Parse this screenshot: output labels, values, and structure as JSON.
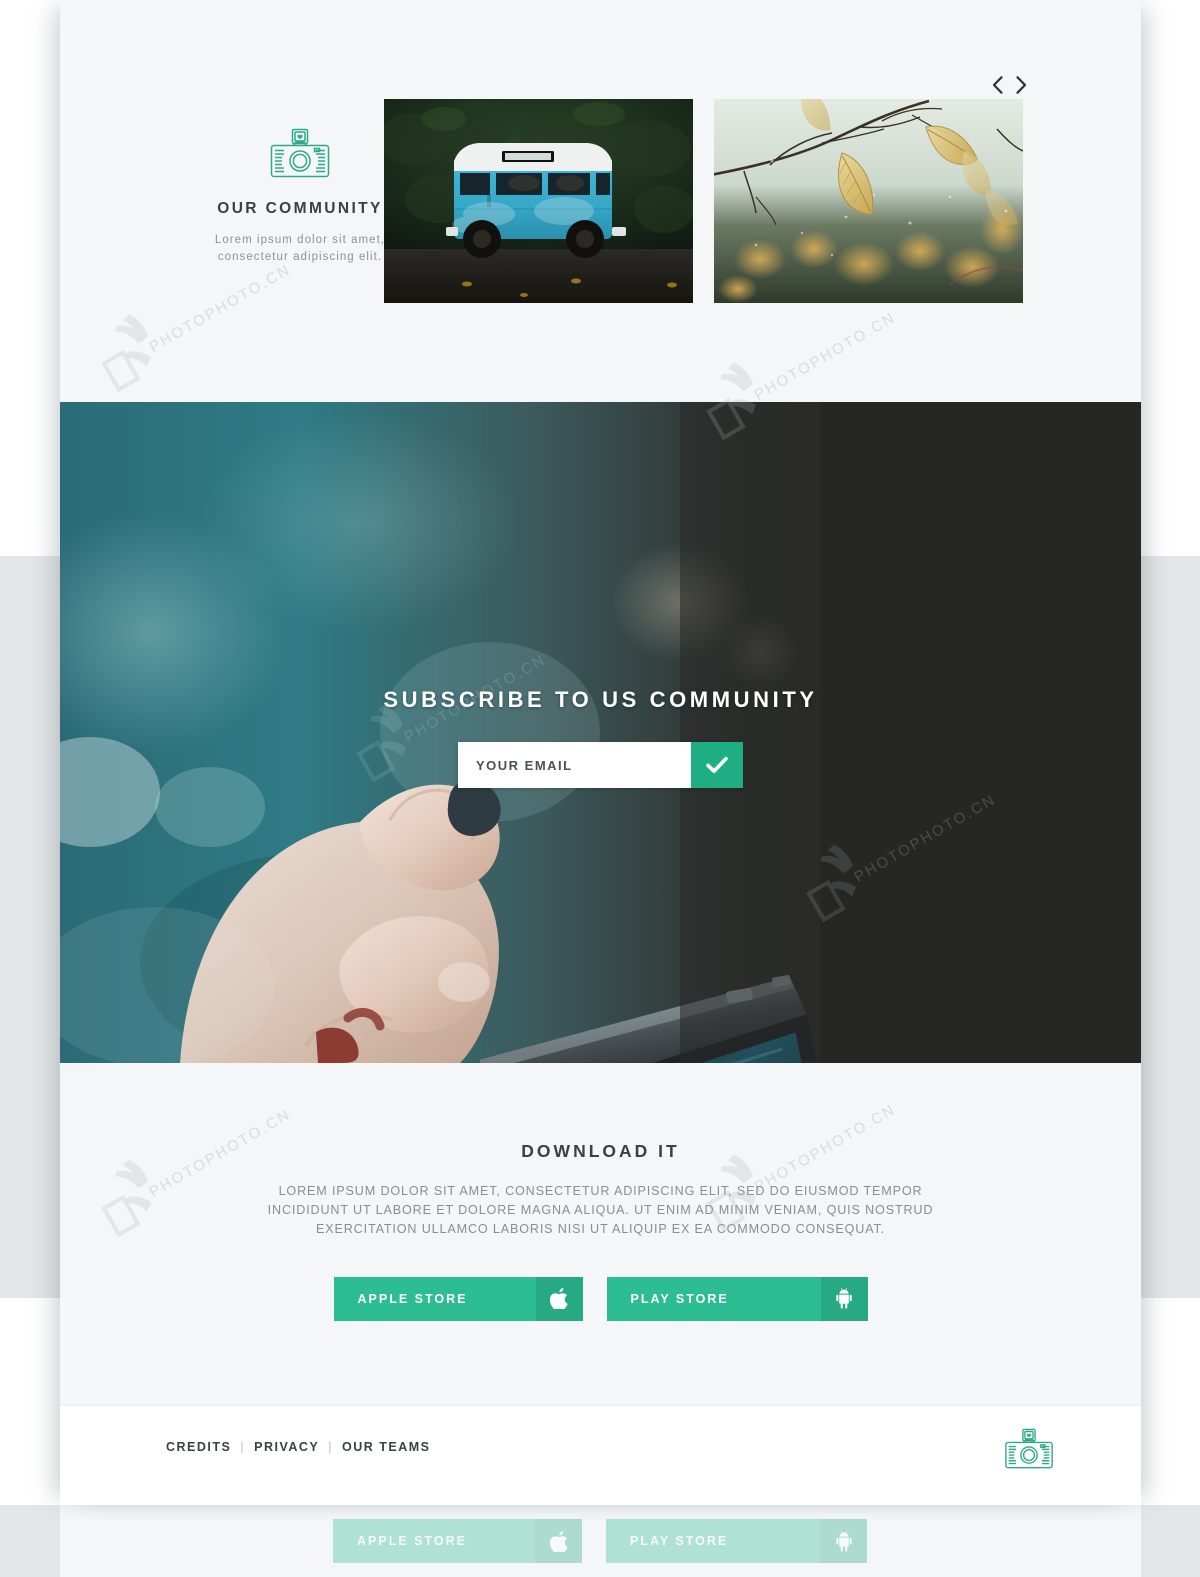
{
  "brand": {
    "accent_teal": "#1fae83",
    "button_green": "#2cbd93",
    "page_bg": "#f4f6f7",
    "text_dark": "#3b4043",
    "text_muted": "#878f93",
    "logo_icon": "camera-heart-icon"
  },
  "community": {
    "title": "OUR COMMUNITY",
    "subtitle": "Lorem ipsum dolor sit amet, consectetur adipiscing elit.",
    "logo_icon": "camera-heart-icon",
    "carousel": {
      "prev_icon": "chevron-left-icon",
      "next_icon": "chevron-right-icon",
      "slides": [
        {
          "alt": "vintage blue camper van parked by dark hedge"
        },
        {
          "alt": "autumn yellow leaves on bare branch, blurred bokeh"
        }
      ]
    }
  },
  "subscribe": {
    "title": "SUBSCRIBE TO US COMMUNITY",
    "email_placeholder": "YOUR EMAIL",
    "email_value": "",
    "submit_icon": "check-icon",
    "background_alt": "hand holding a compact camera, teal blurred background"
  },
  "download": {
    "title": "DOWNLOAD IT",
    "body": "LOREM IPSUM DOLOR SIT AMET, CONSECTETUR ADIPISCING ELIT, SED DO EIUSMOD TEMPOR INCIDIDUNT UT LABORE ET DOLORE MAGNA ALIQUA. UT ENIM AD MINIM VENIAM, QUIS NOSTRUD EXERCITATION ULLAMCO LABORIS NISI UT ALIQUIP EX EA COMMODO CONSEQUAT.",
    "buttons": [
      {
        "label": "APPLE STORE",
        "icon": "apple-icon"
      },
      {
        "label": "PLAY STORE",
        "icon": "android-icon"
      }
    ]
  },
  "footer": {
    "links": [
      {
        "label": "CREDITS"
      },
      {
        "label": "PRIVACY"
      },
      {
        "label": "OUR TEAMS"
      }
    ],
    "separator": "|",
    "logo_icon": "camera-heart-icon"
  },
  "watermark": {
    "text": "PHOTOPHOTO.CN",
    "seal_icon": "chinese-seal-icon"
  }
}
